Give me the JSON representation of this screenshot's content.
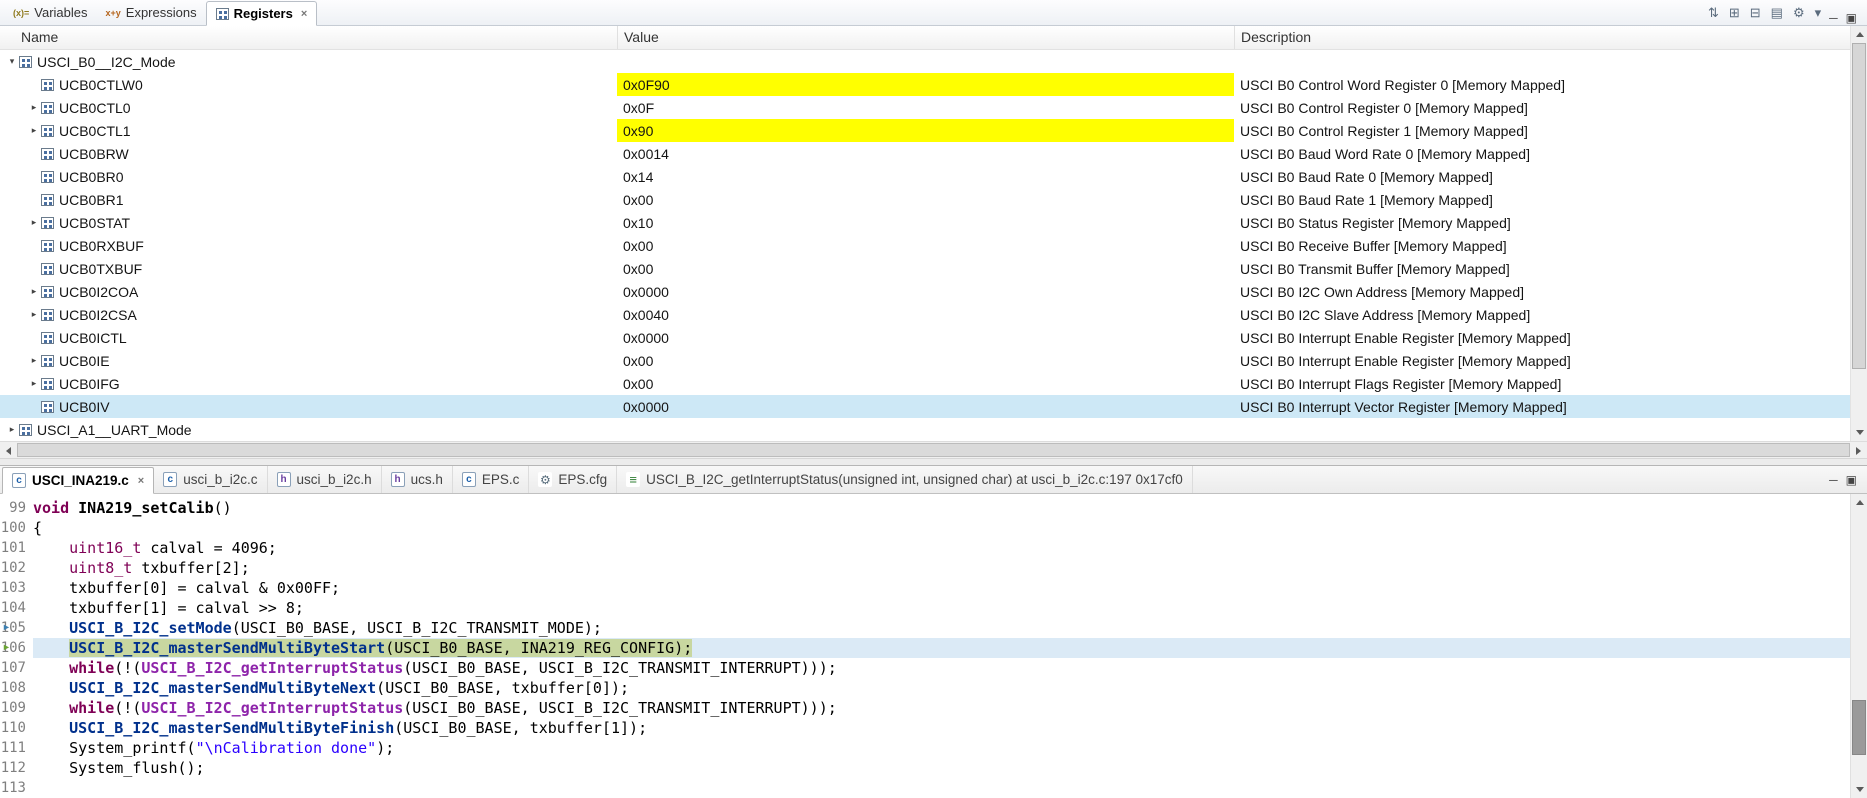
{
  "colors": {
    "changed_value_bg": "#ffff00",
    "selected_row_bg": "#cde8f6",
    "debug_line_row_bg": "#dbeaf6",
    "debug_ip_box_bg": "#c8d7a0"
  },
  "icon_glyphs": {
    "chevron-expanded": "▾",
    "chevron-collapsed": "▸",
    "close": "×",
    "arrow": "►",
    "minimize": "─",
    "restore": "▣"
  },
  "registers_view": {
    "tabs": [
      {
        "label": "Variables",
        "icon": "variables-icon",
        "glyph": "(x)=",
        "active": false
      },
      {
        "label": "Expressions",
        "icon": "expressions-icon",
        "glyph": "x+y",
        "active": false
      },
      {
        "label": "Registers",
        "icon": "registers-icon",
        "glyph": "",
        "active": true,
        "closable": true
      }
    ],
    "toolbar": [
      {
        "name": "export-registers-icon",
        "glyph": "⇅"
      },
      {
        "name": "expand-all-icon",
        "glyph": "⊞"
      },
      {
        "name": "collapse-all-icon",
        "glyph": "⊟"
      },
      {
        "name": "layout-icon",
        "glyph": "▤"
      },
      {
        "name": "settings-icon",
        "glyph": "⚙"
      },
      {
        "name": "view-menu-icon",
        "glyph": "▾"
      }
    ],
    "window_buttons": [
      {
        "name": "minimize-icon",
        "glyph": "─"
      },
      {
        "name": "maximize-icon",
        "glyph": "▣"
      }
    ],
    "columns": [
      "Name",
      "Value",
      "Description"
    ],
    "rows": [
      {
        "name": "USCI_B0__I2C_Mode",
        "value": "",
        "desc": "",
        "group": true,
        "chevron": "expanded"
      },
      {
        "name": "UCB0CTLW0",
        "value": "0x0F90",
        "desc": "USCI B0 Control Word Register 0 [Memory Mapped]",
        "chevron": "none",
        "hl": true
      },
      {
        "name": "UCB0CTL0",
        "value": "0x0F",
        "desc": "USCI B0 Control Register 0 [Memory Mapped]",
        "chevron": "collapsed"
      },
      {
        "name": "UCB0CTL1",
        "value": "0x90",
        "desc": "USCI B0 Control Register 1 [Memory Mapped]",
        "chevron": "collapsed",
        "hl": true
      },
      {
        "name": "UCB0BRW",
        "value": "0x0014",
        "desc": "USCI B0 Baud Word Rate 0 [Memory Mapped]",
        "chevron": "none"
      },
      {
        "name": "UCB0BR0",
        "value": "0x14",
        "desc": "USCI B0 Baud Rate 0 [Memory Mapped]",
        "chevron": "none"
      },
      {
        "name": "UCB0BR1",
        "value": "0x00",
        "desc": "USCI B0 Baud Rate 1 [Memory Mapped]",
        "chevron": "none"
      },
      {
        "name": "UCB0STAT",
        "value": "0x10",
        "desc": "USCI B0 Status Register [Memory Mapped]",
        "chevron": "collapsed"
      },
      {
        "name": "UCB0RXBUF",
        "value": "0x00",
        "desc": "USCI B0 Receive Buffer [Memory Mapped]",
        "chevron": "none"
      },
      {
        "name": "UCB0TXBUF",
        "value": "0x00",
        "desc": "USCI B0 Transmit Buffer [Memory Mapped]",
        "chevron": "none"
      },
      {
        "name": "UCB0I2COA",
        "value": "0x0000",
        "desc": "USCI B0 I2C Own Address [Memory Mapped]",
        "chevron": "collapsed"
      },
      {
        "name": "UCB0I2CSA",
        "value": "0x0040",
        "desc": "USCI B0 I2C Slave Address [Memory Mapped]",
        "chevron": "collapsed"
      },
      {
        "name": "UCB0ICTL",
        "value": "0x0000",
        "desc": "USCI B0 Interrupt Enable Register [Memory Mapped]",
        "chevron": "none"
      },
      {
        "name": "UCB0IE",
        "value": "0x00",
        "desc": "USCI B0 Interrupt Enable Register [Memory Mapped]",
        "chevron": "collapsed"
      },
      {
        "name": "UCB0IFG",
        "value": "0x00",
        "desc": "USCI B0 Interrupt Flags Register [Memory Mapped]",
        "chevron": "collapsed"
      },
      {
        "name": "UCB0IV",
        "value": "0x0000",
        "desc": "USCI B0 Interrupt Vector Register [Memory Mapped]",
        "chevron": "none",
        "selected": true
      },
      {
        "name": "USCI_A1__UART_Mode",
        "value": "",
        "desc": "",
        "group": true,
        "chevron": "collapsed"
      }
    ]
  },
  "editor": {
    "tabs": [
      {
        "label": "USCI_INA219.c",
        "kind": "c",
        "badge": "c",
        "active": true
      },
      {
        "label": "usci_b_i2c.c",
        "kind": "c",
        "badge": "c"
      },
      {
        "label": "usci_b_i2c.h",
        "kind": "h",
        "badge": "h"
      },
      {
        "label": "ucs.h",
        "kind": "h",
        "badge": "h"
      },
      {
        "label": "EPS.c",
        "kind": "c",
        "badge": "c"
      },
      {
        "label": "EPS.cfg",
        "kind": "cfg",
        "badge": "⚙"
      },
      {
        "label": "USCI_B_I2C_getInterruptStatus(unsigned int, unsigned char) at usci_b_i2c.c:197 0x17cf0",
        "kind": "frame",
        "badge": "≡"
      }
    ],
    "window_buttons": [
      {
        "name": "minimize-icon",
        "glyph": "─"
      },
      {
        "name": "maximize-icon",
        "glyph": "▣"
      }
    ],
    "current_line": 106,
    "markers": [
      {
        "line": 105,
        "name": "stack-frame-pointer-icon",
        "color": "#3c7fb1"
      },
      {
        "line": 106,
        "name": "instruction-pointer-icon",
        "color": "#6aa332"
      }
    ],
    "lines": [
      {
        "n": "99",
        "s": [
          [
            "kw",
            "void"
          ],
          [
            "pl",
            " "
          ],
          [
            "fd",
            "INA219_setCalib"
          ],
          [
            "pl",
            "()"
          ]
        ]
      },
      {
        "n": "100",
        "s": [
          [
            "pl",
            "{"
          ]
        ]
      },
      {
        "n": "101",
        "s": [
          [
            "pl",
            "    "
          ],
          [
            "ty",
            "uint16_t"
          ],
          [
            "pl",
            " calval = 4096;"
          ]
        ]
      },
      {
        "n": "102",
        "s": [
          [
            "pl",
            "    "
          ],
          [
            "ty",
            "uint8_t"
          ],
          [
            "pl",
            " txbuffer[2];"
          ]
        ]
      },
      {
        "n": "103",
        "s": [
          [
            "pl",
            "    txbuffer[0] = calval & 0x00FF;"
          ]
        ]
      },
      {
        "n": "104",
        "s": [
          [
            "pl",
            "    txbuffer[1] = calval >> 8;"
          ]
        ]
      },
      {
        "n": "105",
        "s": [
          [
            "pl",
            "    "
          ],
          [
            "fn",
            "USCI_B_I2C_setMode"
          ],
          [
            "pl",
            "(USCI_B0_BASE, USCI_B_I2C_TRANSMIT_MODE);"
          ]
        ]
      },
      {
        "n": "106",
        "cur": true,
        "s": [
          [
            "pl",
            "    "
          ],
          [
            "fn",
            "USCI_B_I2C_masterSendMultiByteStart"
          ],
          [
            "pl",
            "(USCI_B0_BASE, INA219_REG_CONFIG);"
          ]
        ]
      },
      {
        "n": "107",
        "s": [
          [
            "pl",
            "    "
          ],
          [
            "kw",
            "while"
          ],
          [
            "pl",
            "(!("
          ],
          [
            "fnp",
            "USCI_B_I2C_getInterruptStatus"
          ],
          [
            "pl",
            "(USCI_B0_BASE, USCI_B_I2C_TRANSMIT_INTERRUPT)));"
          ]
        ]
      },
      {
        "n": "108",
        "s": [
          [
            "pl",
            "    "
          ],
          [
            "fn",
            "USCI_B_I2C_masterSendMultiByteNext"
          ],
          [
            "pl",
            "(USCI_B0_BASE, txbuffer[0]);"
          ]
        ]
      },
      {
        "n": "109",
        "s": [
          [
            "pl",
            "    "
          ],
          [
            "kw",
            "while"
          ],
          [
            "pl",
            "(!("
          ],
          [
            "fnp",
            "USCI_B_I2C_getInterruptStatus"
          ],
          [
            "pl",
            "(USCI_B0_BASE, USCI_B_I2C_TRANSMIT_INTERRUPT)));"
          ]
        ]
      },
      {
        "n": "110",
        "s": [
          [
            "pl",
            "    "
          ],
          [
            "fn",
            "USCI_B_I2C_masterSendMultiByteFinish"
          ],
          [
            "pl",
            "(USCI_B0_BASE, txbuffer[1]);"
          ]
        ]
      },
      {
        "n": "111",
        "s": [
          [
            "pl",
            "    System_printf("
          ],
          [
            "str",
            "\"\\nCalibration done\""
          ],
          [
            "pl",
            ");"
          ]
        ]
      },
      {
        "n": "112",
        "s": [
          [
            "pl",
            "    System_flush();"
          ]
        ]
      },
      {
        "n": "113",
        "s": []
      }
    ]
  }
}
